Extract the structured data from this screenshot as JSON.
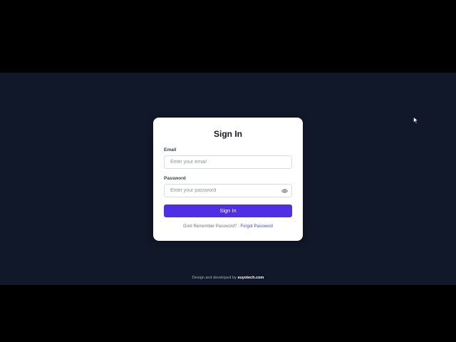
{
  "login": {
    "title": "Sign In",
    "email_label": "Email",
    "email_placeholder": "Enter your email",
    "password_label": "Password",
    "password_placeholder": "Enter your password",
    "password_toggle_icon": "eye-icon",
    "submit_label": "Sign In",
    "helper_text": "Dont Remember Password? :",
    "forgot_link": "Forgot Password"
  },
  "footer": {
    "text": "Design and developed by",
    "brand": "suyotech.com"
  },
  "colors": {
    "page_background": "#111829",
    "card_background": "#ffffff",
    "primary": "#4f2fe6",
    "link": "#3b4bd1"
  }
}
